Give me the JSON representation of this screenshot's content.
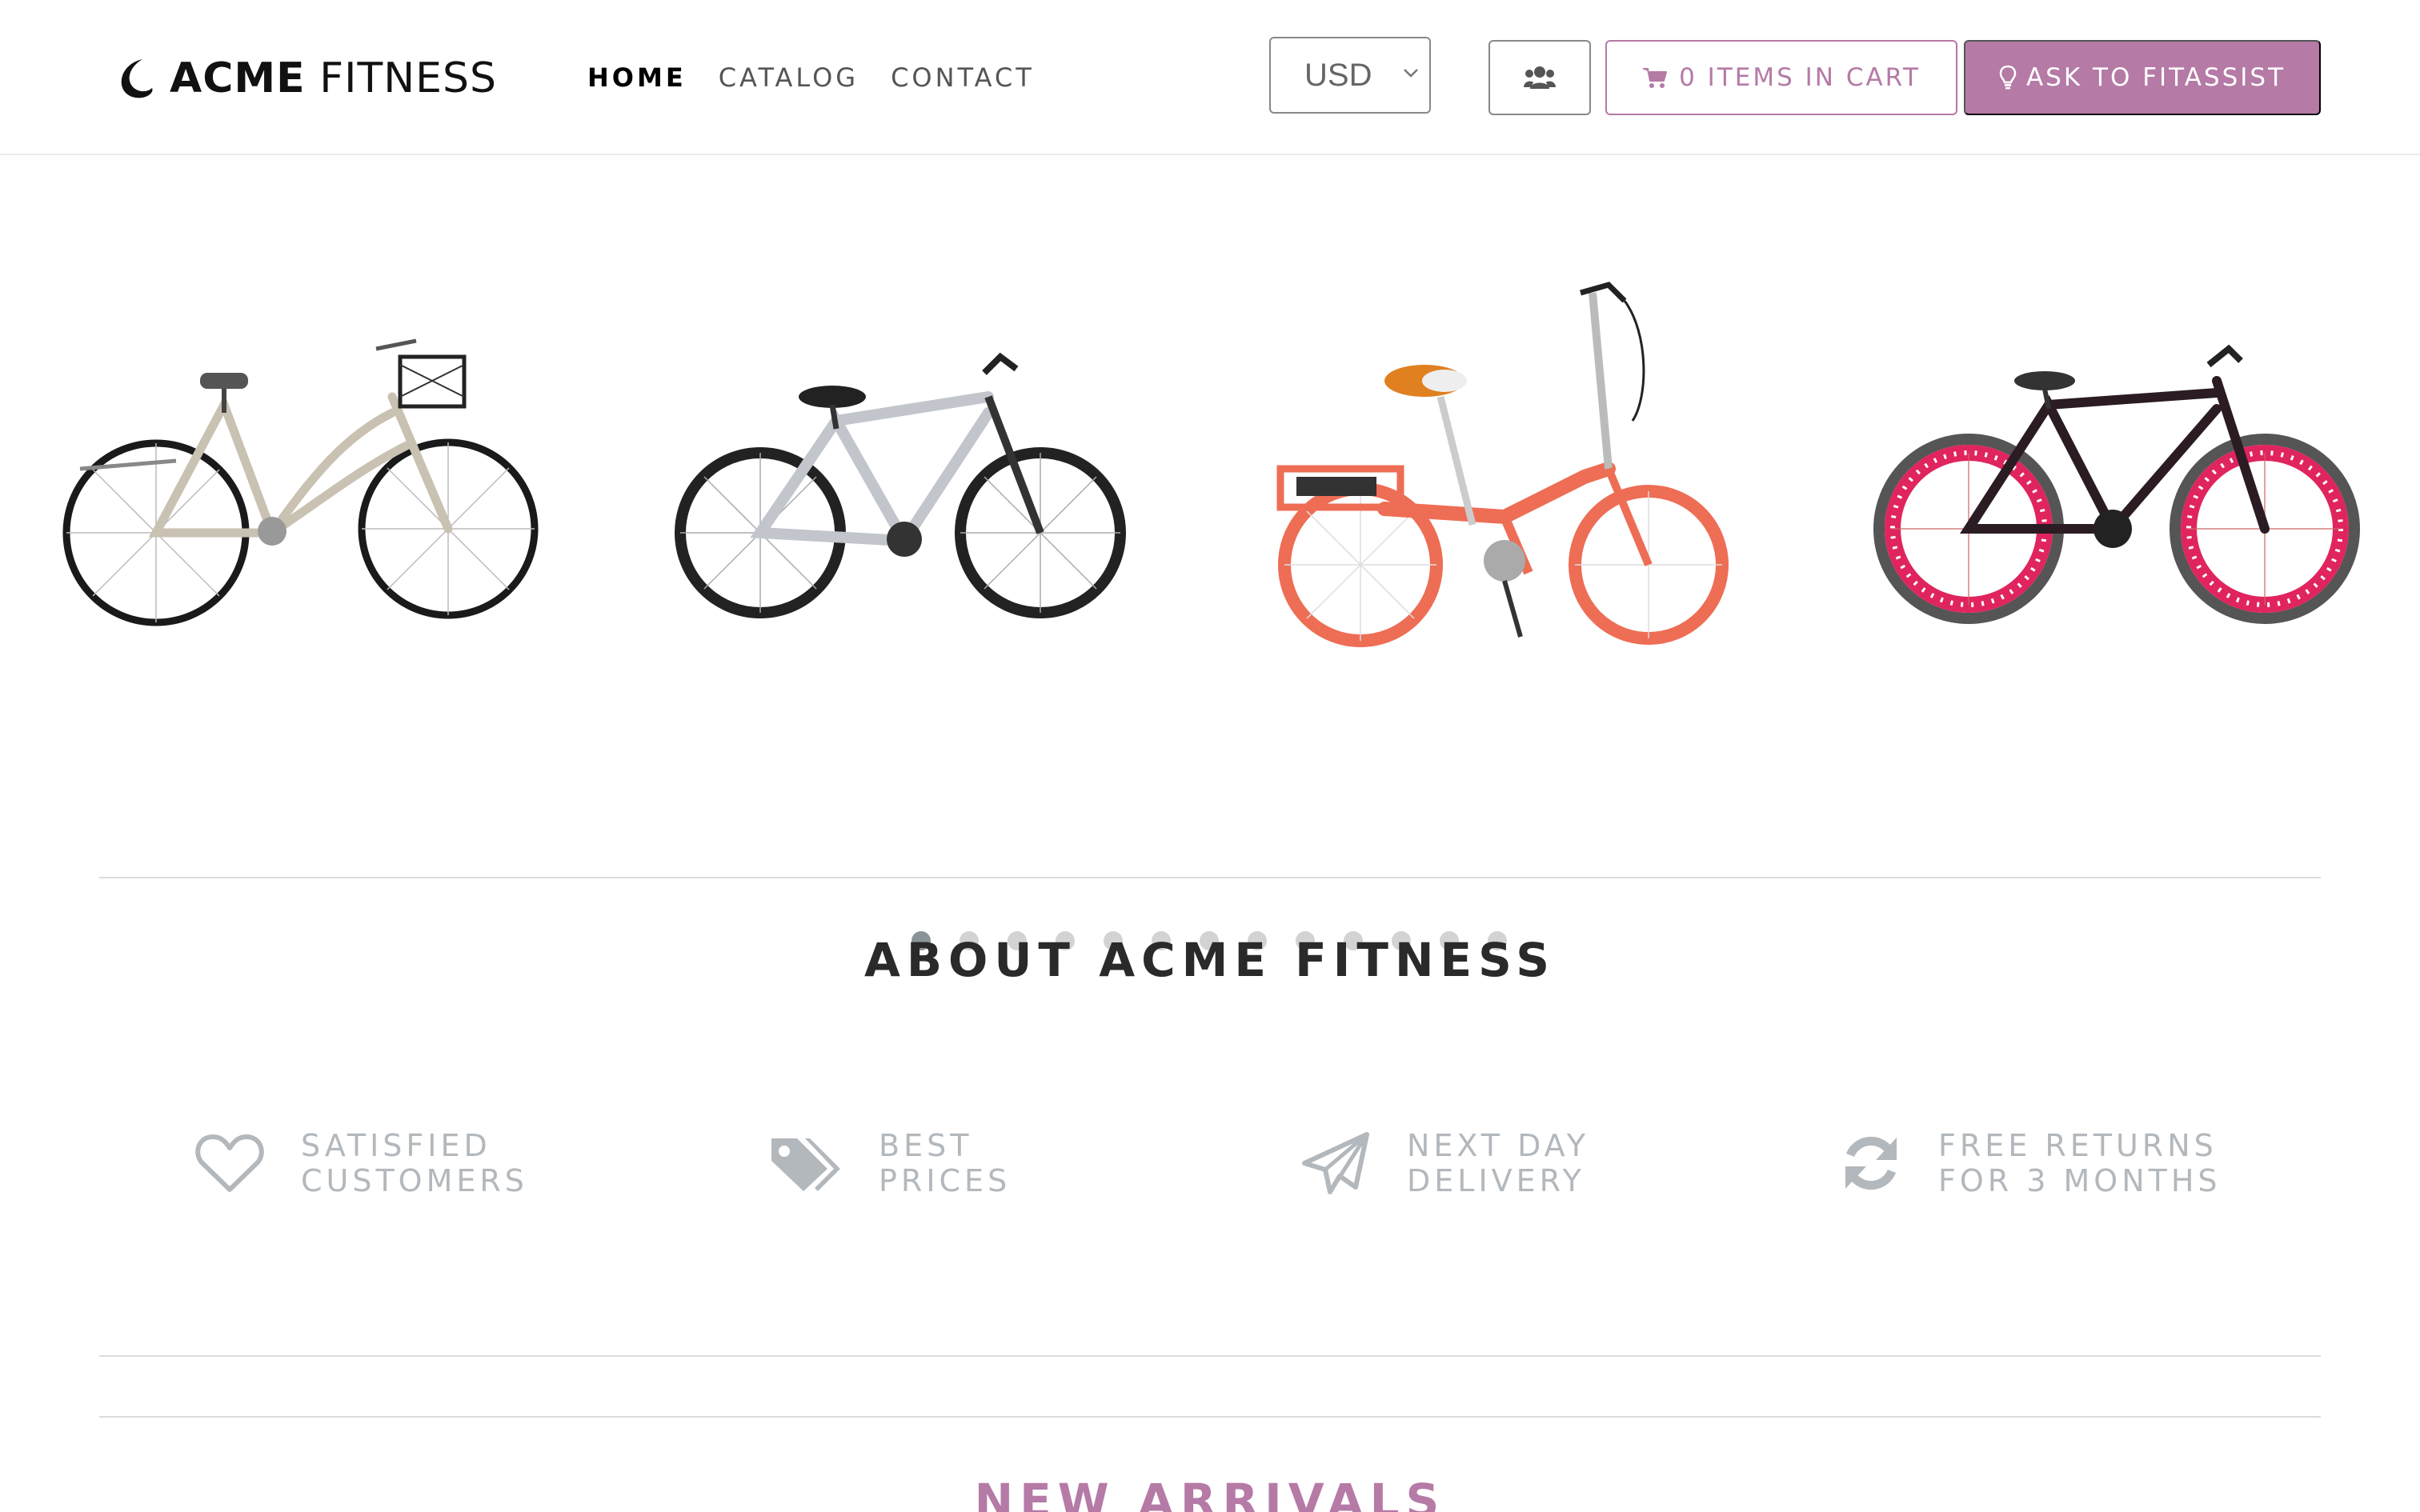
{
  "header": {
    "logo": {
      "brand_bold": "ACME",
      "brand_light": " FITNESS",
      "icon": "crescent-logo-icon"
    },
    "nav": [
      {
        "label": "HOME",
        "active": true
      },
      {
        "label": "CATALOG",
        "active": false
      },
      {
        "label": "CONTACT",
        "active": false
      }
    ],
    "currency": {
      "selected": "USD",
      "icon": "chevron-down-icon"
    },
    "users_button": {
      "icon": "users-icon"
    },
    "cart_button": {
      "label": "0 ITEMS IN CART",
      "icon": "shopping-cart-icon"
    },
    "ask_button": {
      "label": "ASK TO FITASSIST",
      "icon": "lightbulb-icon"
    }
  },
  "carousel": {
    "items": [
      {
        "name": "city-bike-with-basket",
        "frame_color": "#c9c1b2"
      },
      {
        "name": "mountain-bike-silver",
        "frame_color": "#c2c6cc"
      },
      {
        "name": "folding-ebike-orange",
        "frame_color": "#ee6d55"
      },
      {
        "name": "fixie-bike-red-rims",
        "frame_color": "#2b1c24"
      }
    ],
    "page_count": 13,
    "active_page": 1
  },
  "about": {
    "title": "ABOUT ACME FITNESS",
    "features": [
      {
        "line1": "SATISFIED",
        "line2": "CUSTOMERS",
        "icon": "heart-icon"
      },
      {
        "line1": "BEST",
        "line2": "PRICES",
        "icon": "tags-icon"
      },
      {
        "line1": "NEXT DAY",
        "line2": "DELIVERY",
        "icon": "paper-plane-icon"
      },
      {
        "line1": "FREE RETURNS",
        "line2": "FOR 3 MONTHS",
        "icon": "refresh-icon"
      }
    ]
  },
  "new_arrivals": {
    "title": "NEW ARRIVALS"
  },
  "colors": {
    "accent": "#b57aa6",
    "muted_text": "#b3b8bd",
    "divider": "#dcdcdc"
  }
}
